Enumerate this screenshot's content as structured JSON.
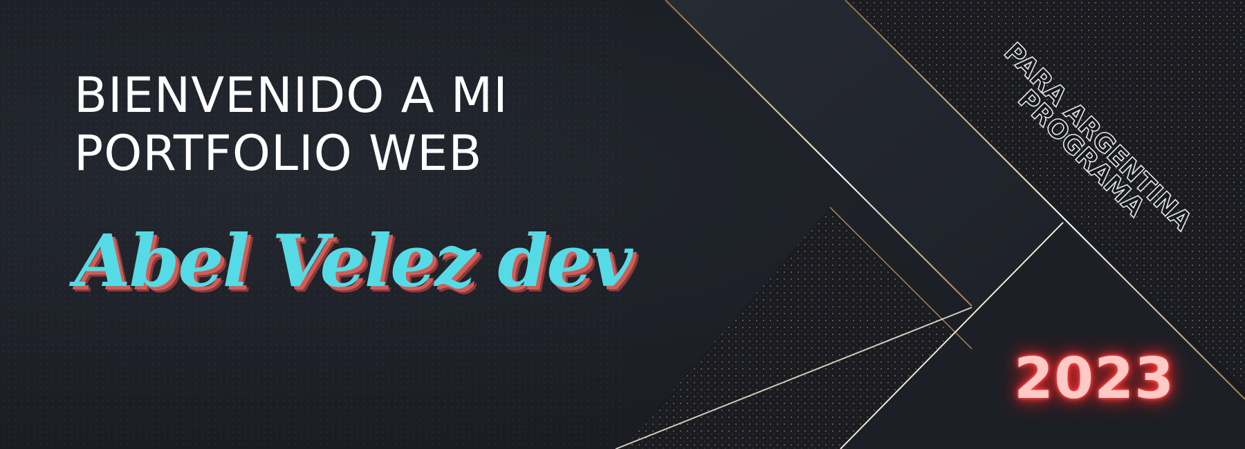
{
  "banner": {
    "title_line_1": "BIENVENIDO A MI",
    "title_line_2": "PORTFOLIO WEB",
    "name": "Abel Velez dev",
    "tagline_line_1": "PARA ARGENTINA",
    "tagline_line_2": "PROGRAMA",
    "year": "2023"
  },
  "colors": {
    "background": "#1b1e25",
    "title": "#ffffff",
    "name": "#55dbe6",
    "name_shadow": "#d25d57",
    "year_glow": "#ff3b3b",
    "gold_line": "#c9a45a"
  }
}
